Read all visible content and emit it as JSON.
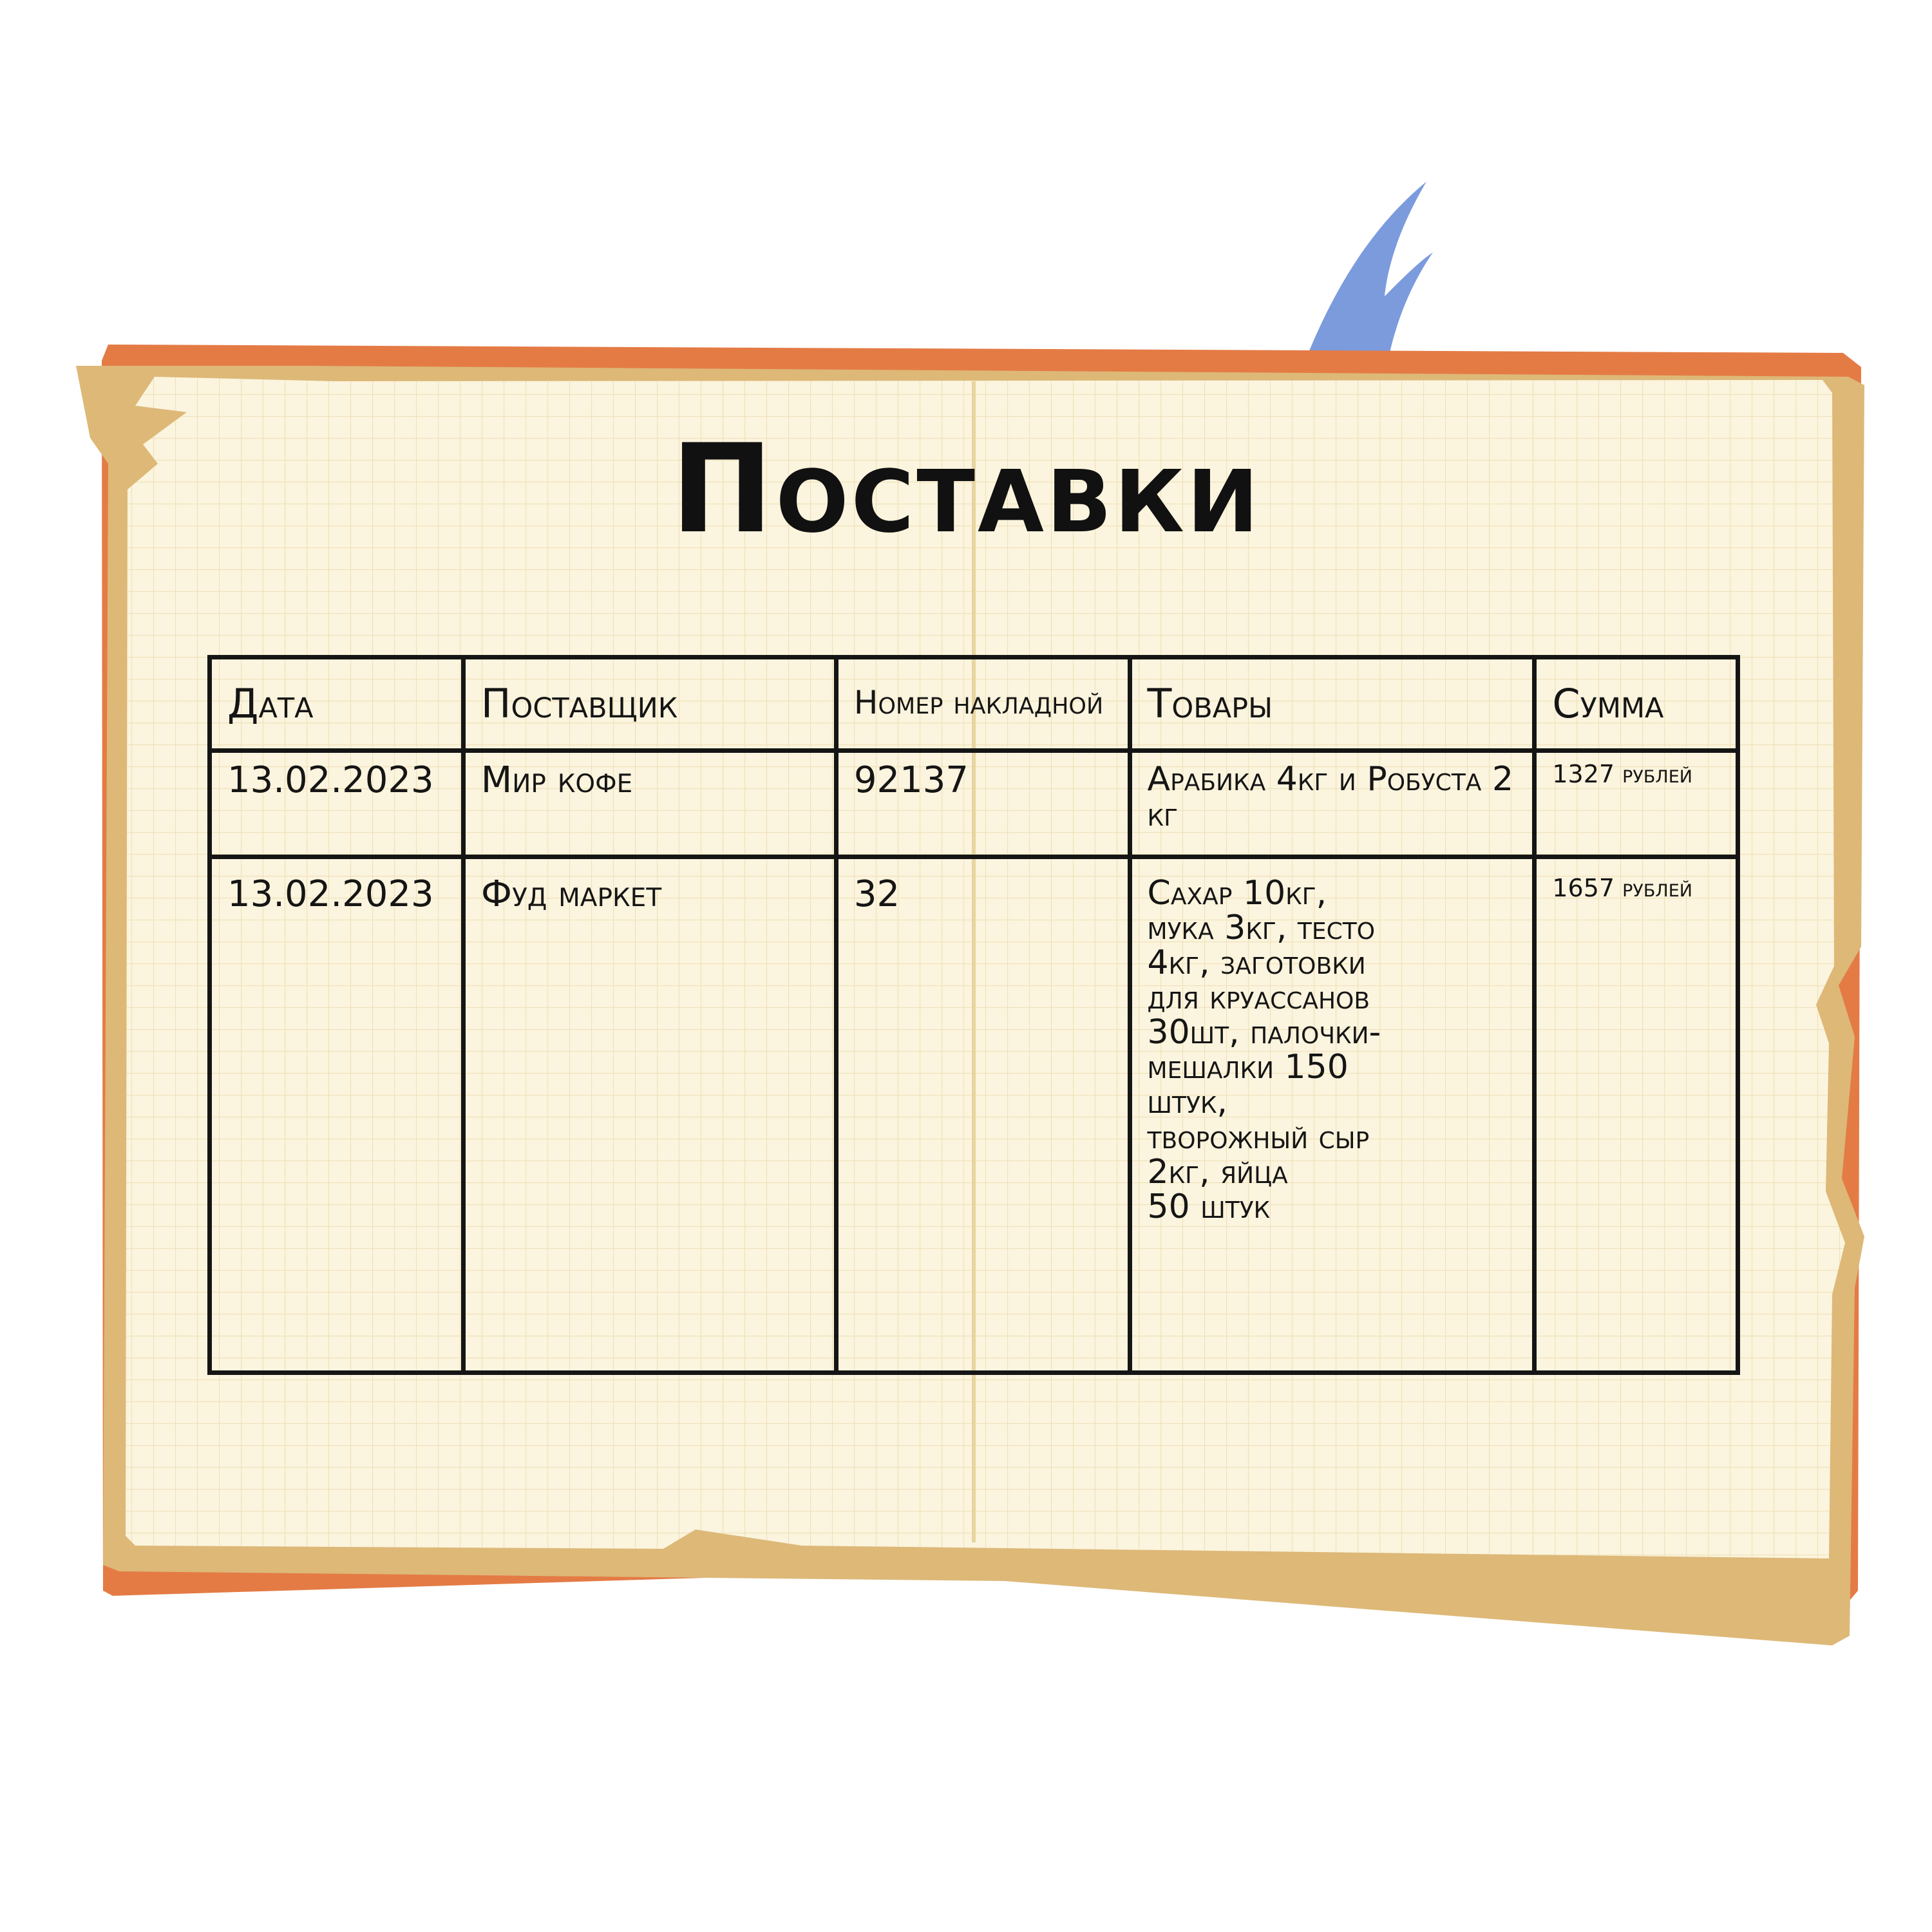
{
  "title": "Поставки",
  "table": {
    "headers": {
      "date": "Дата",
      "supplier": "Поставщик",
      "invoice": "Номер накладной",
      "goods": "Товары",
      "sum": "Сумма"
    },
    "rows": [
      {
        "date": "13.02.2023",
        "supplier": "Мир кофе",
        "invoice": "92137",
        "goods": "Арабика 4кг и Робуста 2 кг",
        "sum": "1327 рублей"
      },
      {
        "date": "13.02.2023",
        "supplier": "Фуд маркет",
        "invoice": "32",
        "goods": "Сахар 10кг,\nмука 3кг, тесто\n4кг, заготовки\nдля круассанов\n30шт, палочки-\nмешалки 150\nштук,\nтворожный сыр\n2кг, яйца\n50 штук",
        "sum": "1657 рублей"
      }
    ]
  },
  "colors": {
    "cover": "#E47B45",
    "paper_back": "#DDB877",
    "paper": "#FBF4DE",
    "grid": "#EEDFB4",
    "bookmark": "#7B9BDD",
    "ink": "#151515"
  }
}
